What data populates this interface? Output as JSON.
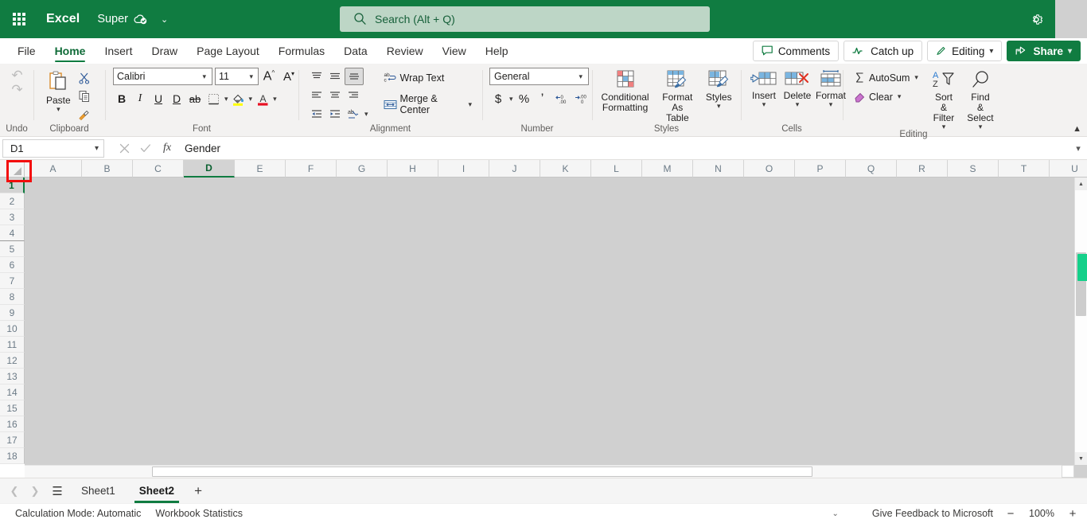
{
  "titlebar": {
    "waffle_label": "App launcher",
    "brand": "Excel",
    "document_name": "Super",
    "cloud_status_icon": "cloud-saved-icon",
    "doc_chevron": "⌄",
    "search_placeholder": "Search (Alt + Q)",
    "search_value": "",
    "settings_icon": "gear-icon"
  },
  "tabs": {
    "items": [
      {
        "label": "File",
        "active": false
      },
      {
        "label": "Home",
        "active": true
      },
      {
        "label": "Insert",
        "active": false
      },
      {
        "label": "Draw",
        "active": false
      },
      {
        "label": "Page Layout",
        "active": false
      },
      {
        "label": "Formulas",
        "active": false
      },
      {
        "label": "Data",
        "active": false
      },
      {
        "label": "Review",
        "active": false
      },
      {
        "label": "View",
        "active": false
      },
      {
        "label": "Help",
        "active": false
      }
    ],
    "right_buttons": [
      {
        "label": "Comments",
        "icon": "comment-icon",
        "chevron": false,
        "primary": false
      },
      {
        "label": "Catch up",
        "icon": "catchup-icon",
        "chevron": false,
        "primary": false
      },
      {
        "label": "Editing",
        "icon": "pencil-icon",
        "chevron": true,
        "primary": false
      },
      {
        "label": "Share",
        "icon": "share-icon",
        "chevron": true,
        "primary": true
      }
    ]
  },
  "ribbon": {
    "groups": {
      "undo": {
        "label": "Undo",
        "undo_icon": "undo-arrow-icon",
        "redo_icon": "redo-arrow-icon"
      },
      "clipboard": {
        "label": "Clipboard",
        "paste_label": "Paste",
        "cut_icon": "scissors-icon",
        "copy_icon": "copy-icon",
        "format_painter_icon": "format-painter-icon"
      },
      "font": {
        "label": "Font",
        "font_name": "Calibri",
        "font_size": "11",
        "grow_font_label": "A",
        "shrink_font_label": "A",
        "bold_label": "B",
        "italic_label": "I",
        "underline_label": "U",
        "double_underline_label": "D",
        "strikethrough_label": "ab",
        "borders_icon": "borders-icon",
        "fill_color_icon": "fill-color-icon",
        "font_color_icon": "font-color-icon"
      },
      "alignment": {
        "label": "Alignment",
        "wrap_text_label": "Wrap Text",
        "merge_center_label": "Merge & Center",
        "align_top_icon": "align-top-icon",
        "align_middle_icon": "align-middle-icon",
        "align_bottom_icon": "align-bottom-icon",
        "align_left_icon": "align-left-icon",
        "align_center_icon": "align-center-icon",
        "align_right_icon": "align-right-icon",
        "decrease_indent_icon": "decrease-indent-icon",
        "increase_indent_icon": "increase-indent-icon",
        "orientation_icon": "text-orientation-icon"
      },
      "number": {
        "label": "Number",
        "format_value": "General",
        "currency_label": "$",
        "percent_label": "%",
        "comma_label": "’",
        "increase_decimal_icon": "increase-decimal-icon",
        "decrease_decimal_icon": "decrease-decimal-icon"
      },
      "styles": {
        "label": "Styles",
        "conditional_formatting_label": "Conditional Formatting",
        "format_as_table_label": "Format As Table",
        "styles_label": "Styles"
      },
      "cells": {
        "label": "Cells",
        "insert_label": "Insert",
        "delete_label": "Delete",
        "format_label": "Format"
      },
      "editing": {
        "label": "Editing",
        "autosum_label": "AutoSum",
        "clear_label": "Clear",
        "sort_filter_label": "Sort & Filter",
        "find_select_label": "Find & Select"
      }
    },
    "collapse_icon": "chevron-up-icon"
  },
  "formula_bar": {
    "name_box_value": "D1",
    "name_box_chevron": "⌄",
    "cancel_icon": "close-icon",
    "confirm_icon": "check-icon",
    "function_icon": "fx-icon",
    "formula_value": "Gender",
    "formula_placeholder": "",
    "expand_icon": "chevron-down-icon"
  },
  "grid": {
    "select_all_corner": "select-all-corner",
    "columns": [
      "A",
      "B",
      "C",
      "D",
      "E",
      "F",
      "G",
      "H",
      "I",
      "J",
      "K",
      "L",
      "M",
      "N",
      "O",
      "P",
      "Q",
      "R",
      "S",
      "T",
      "U"
    ],
    "selected_column": "D",
    "rows": [
      "1",
      "2",
      "3",
      "4",
      "5",
      "6",
      "7",
      "8",
      "9",
      "10",
      "11",
      "12",
      "13",
      "14",
      "15",
      "16",
      "17",
      "18"
    ],
    "selected_row": "1"
  },
  "sheet_bar": {
    "prev_icon": "chevron-left-icon",
    "next_icon": "chevron-right-icon",
    "all_sheets_icon": "hamburger-icon",
    "tabs": [
      {
        "label": "Sheet1",
        "active": false
      },
      {
        "label": "Sheet2",
        "active": true
      }
    ],
    "add_sheet_label": "+"
  },
  "status_bar": {
    "calculation_mode": "Calculation Mode: Automatic",
    "workbook_statistics": "Workbook Statistics",
    "overflow_chevron": "⌄",
    "feedback": "Give Feedback to Microsoft",
    "zoom_out_label": "−",
    "zoom_value": "100%",
    "zoom_in_label": "+"
  },
  "colors": {
    "brand_green": "#107c41",
    "search_bg": "#bdd6c6",
    "ribbon_bg": "#f3f2f1",
    "selection_gray": "#d0d0d0",
    "highlight_red": "#f30d0d",
    "scroll_marker_green": "#15d08a"
  }
}
